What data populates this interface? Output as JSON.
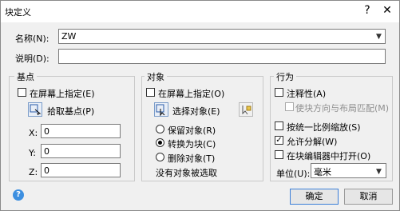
{
  "window": {
    "title": "块定义",
    "help_glyph": "?",
    "close_glyph": "✕"
  },
  "name": {
    "label": "名称(N):",
    "value": "ZW"
  },
  "description": {
    "label": "说明(D):",
    "value": ""
  },
  "base_point": {
    "group_title": "基点",
    "specify_on_screen": "在屏幕上指定(E)",
    "pick_button": "拾取基点(P)",
    "x_label": "X:",
    "x_value": "0",
    "y_label": "Y:",
    "y_value": "0",
    "z_label": "Z:",
    "z_value": "0"
  },
  "objects": {
    "group_title": "对象",
    "specify_on_screen": "在屏幕上指定(O)",
    "select_button": "选择对象(E)",
    "retain": "保留对象(R)",
    "convert": "转换为块(C)",
    "delete": "删除对象(T)",
    "status": "没有对象被选取"
  },
  "behavior": {
    "group_title": "行为",
    "annotative": "注释性(A)",
    "match_orientation": "使块方向与布局匹配(M)",
    "scale_uniformly": "按统一比例缩放(S)",
    "allow_explode": "允许分解(W)",
    "open_in_editor": "在块编辑器中打开(O)",
    "unit_label": "单位(U):",
    "unit_value": "毫米"
  },
  "buttons": {
    "ok": "确定",
    "cancel": "取消"
  },
  "info_icon_glyph": "?"
}
